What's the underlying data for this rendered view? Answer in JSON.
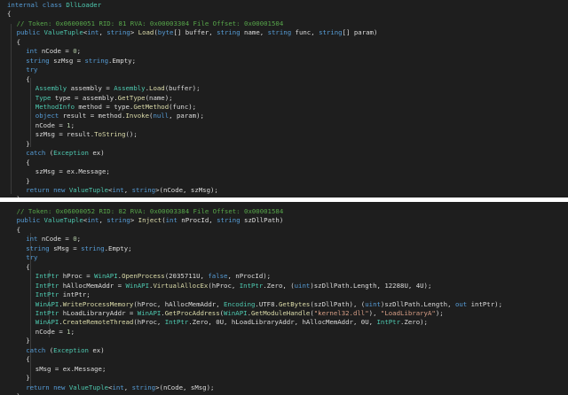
{
  "pane1": {
    "lines": [
      {
        "indent": 0,
        "parts": [
          {
            "k": "kw",
            "t": "internal class "
          },
          {
            "k": "type",
            "t": "DllLoader"
          }
        ]
      },
      {
        "indent": 0,
        "parts": [
          {
            "k": "plain",
            "t": "{"
          }
        ]
      },
      {
        "indent": 1,
        "parts": [
          {
            "k": "comment",
            "t": "// Token: 0x06000051 RID: 81 RVA: 0x00003304 File Offset: 0x00001504"
          }
        ]
      },
      {
        "indent": 1,
        "parts": [
          {
            "k": "kw",
            "t": "public "
          },
          {
            "k": "type",
            "t": "ValueTuple"
          },
          {
            "k": "plain",
            "t": "<"
          },
          {
            "k": "kw",
            "t": "int"
          },
          {
            "k": "plain",
            "t": ", "
          },
          {
            "k": "kw",
            "t": "string"
          },
          {
            "k": "plain",
            "t": "> "
          },
          {
            "k": "method",
            "t": "Load"
          },
          {
            "k": "plain",
            "t": "("
          },
          {
            "k": "kw",
            "t": "byte"
          },
          {
            "k": "plain",
            "t": "[] buffer, "
          },
          {
            "k": "kw",
            "t": "string"
          },
          {
            "k": "plain",
            "t": " name, "
          },
          {
            "k": "kw",
            "t": "string"
          },
          {
            "k": "plain",
            "t": " func, "
          },
          {
            "k": "kw",
            "t": "string"
          },
          {
            "k": "plain",
            "t": "[] param)"
          }
        ]
      },
      {
        "indent": 1,
        "parts": [
          {
            "k": "plain",
            "t": "{"
          }
        ]
      },
      {
        "indent": 2,
        "parts": [
          {
            "k": "kw",
            "t": "int"
          },
          {
            "k": "plain",
            "t": " nCode = "
          },
          {
            "k": "num",
            "t": "0"
          },
          {
            "k": "plain",
            "t": ";"
          }
        ]
      },
      {
        "indent": 2,
        "parts": [
          {
            "k": "kw",
            "t": "string"
          },
          {
            "k": "plain",
            "t": " szMsg = "
          },
          {
            "k": "kw",
            "t": "string"
          },
          {
            "k": "plain",
            "t": ".Empty;"
          }
        ]
      },
      {
        "indent": 2,
        "parts": [
          {
            "k": "kw",
            "t": "try"
          }
        ]
      },
      {
        "indent": 2,
        "parts": [
          {
            "k": "plain",
            "t": "{"
          }
        ]
      },
      {
        "indent": 3,
        "parts": [
          {
            "k": "type",
            "t": "Assembly"
          },
          {
            "k": "plain",
            "t": " assembly = "
          },
          {
            "k": "type",
            "t": "Assembly"
          },
          {
            "k": "plain",
            "t": "."
          },
          {
            "k": "method",
            "t": "Load"
          },
          {
            "k": "plain",
            "t": "(buffer);"
          }
        ]
      },
      {
        "indent": 3,
        "parts": [
          {
            "k": "type",
            "t": "Type"
          },
          {
            "k": "plain",
            "t": " type = assembly."
          },
          {
            "k": "method",
            "t": "GetType"
          },
          {
            "k": "plain",
            "t": "(name);"
          }
        ]
      },
      {
        "indent": 3,
        "parts": [
          {
            "k": "type",
            "t": "MethodInfo"
          },
          {
            "k": "plain",
            "t": " method = type."
          },
          {
            "k": "method",
            "t": "GetMethod"
          },
          {
            "k": "plain",
            "t": "(func);"
          }
        ]
      },
      {
        "indent": 3,
        "parts": [
          {
            "k": "kw",
            "t": "object"
          },
          {
            "k": "plain",
            "t": " result = method."
          },
          {
            "k": "method",
            "t": "Invoke"
          },
          {
            "k": "plain",
            "t": "("
          },
          {
            "k": "kw",
            "t": "null"
          },
          {
            "k": "plain",
            "t": ", param);"
          }
        ]
      },
      {
        "indent": 3,
        "parts": [
          {
            "k": "plain",
            "t": "nCode = "
          },
          {
            "k": "num",
            "t": "1"
          },
          {
            "k": "plain",
            "t": ";"
          }
        ]
      },
      {
        "indent": 3,
        "parts": [
          {
            "k": "plain",
            "t": "szMsg = result."
          },
          {
            "k": "method",
            "t": "ToString"
          },
          {
            "k": "plain",
            "t": "();"
          }
        ]
      },
      {
        "indent": 2,
        "parts": [
          {
            "k": "plain",
            "t": "}"
          }
        ]
      },
      {
        "indent": 2,
        "parts": [
          {
            "k": "kw",
            "t": "catch"
          },
          {
            "k": "plain",
            "t": " ("
          },
          {
            "k": "type",
            "t": "Exception"
          },
          {
            "k": "plain",
            "t": " ex)"
          }
        ]
      },
      {
        "indent": 2,
        "parts": [
          {
            "k": "plain",
            "t": "{"
          }
        ]
      },
      {
        "indent": 3,
        "parts": [
          {
            "k": "plain",
            "t": "szMsg = ex.Message;"
          }
        ]
      },
      {
        "indent": 2,
        "parts": [
          {
            "k": "plain",
            "t": "}"
          }
        ]
      },
      {
        "indent": 2,
        "parts": [
          {
            "k": "kw",
            "t": "return new "
          },
          {
            "k": "type",
            "t": "ValueTuple"
          },
          {
            "k": "plain",
            "t": "<"
          },
          {
            "k": "kw",
            "t": "int"
          },
          {
            "k": "plain",
            "t": ", "
          },
          {
            "k": "kw",
            "t": "string"
          },
          {
            "k": "plain",
            "t": ">(nCode, szMsg);"
          }
        ]
      },
      {
        "indent": 1,
        "parts": [
          {
            "k": "plain",
            "t": "}"
          }
        ]
      }
    ]
  },
  "pane2": {
    "lines": [
      {
        "indent": 1,
        "parts": [
          {
            "k": "comment",
            "t": "// Token: 0x06000052 RID: 82 RVA: 0x00003384 File Offset: 0x00001584"
          }
        ]
      },
      {
        "indent": 1,
        "parts": [
          {
            "k": "kw",
            "t": "public "
          },
          {
            "k": "type",
            "t": "ValueTuple"
          },
          {
            "k": "plain",
            "t": "<"
          },
          {
            "k": "kw",
            "t": "int"
          },
          {
            "k": "plain",
            "t": ", "
          },
          {
            "k": "kw",
            "t": "string"
          },
          {
            "k": "plain",
            "t": "> "
          },
          {
            "k": "method",
            "t": "Inject"
          },
          {
            "k": "plain",
            "t": "("
          },
          {
            "k": "kw",
            "t": "int"
          },
          {
            "k": "plain",
            "t": " nProcId, "
          },
          {
            "k": "kw",
            "t": "string"
          },
          {
            "k": "plain",
            "t": " szDllPath)"
          }
        ]
      },
      {
        "indent": 1,
        "parts": [
          {
            "k": "plain",
            "t": "{"
          }
        ]
      },
      {
        "indent": 2,
        "parts": [
          {
            "k": "kw",
            "t": "int"
          },
          {
            "k": "plain",
            "t": " nCode = "
          },
          {
            "k": "num",
            "t": "0"
          },
          {
            "k": "plain",
            "t": ";"
          }
        ]
      },
      {
        "indent": 2,
        "parts": [
          {
            "k": "kw",
            "t": "string"
          },
          {
            "k": "plain",
            "t": " sMsg = "
          },
          {
            "k": "kw",
            "t": "string"
          },
          {
            "k": "plain",
            "t": ".Empty;"
          }
        ]
      },
      {
        "indent": 2,
        "parts": [
          {
            "k": "kw",
            "t": "try"
          }
        ]
      },
      {
        "indent": 2,
        "parts": [
          {
            "k": "plain",
            "t": "{"
          }
        ]
      },
      {
        "indent": 3,
        "parts": [
          {
            "k": "type",
            "t": "IntPtr"
          },
          {
            "k": "plain",
            "t": " hProc = "
          },
          {
            "k": "type",
            "t": "WinAPI"
          },
          {
            "k": "plain",
            "t": "."
          },
          {
            "k": "method",
            "t": "OpenProcess"
          },
          {
            "k": "plain",
            "t": "(2035711U, "
          },
          {
            "k": "kw",
            "t": "false"
          },
          {
            "k": "plain",
            "t": ", nProcId);"
          }
        ]
      },
      {
        "indent": 3,
        "parts": [
          {
            "k": "type",
            "t": "IntPtr"
          },
          {
            "k": "plain",
            "t": " hAllocMemAddr = "
          },
          {
            "k": "type",
            "t": "WinAPI"
          },
          {
            "k": "plain",
            "t": "."
          },
          {
            "k": "method",
            "t": "VirtualAllocEx"
          },
          {
            "k": "plain",
            "t": "(hProc, "
          },
          {
            "k": "type",
            "t": "IntPtr"
          },
          {
            "k": "plain",
            "t": ".Zero, ("
          },
          {
            "k": "kw",
            "t": "uint"
          },
          {
            "k": "plain",
            "t": ")szDllPath.Length, 12288U, 4U);"
          }
        ]
      },
      {
        "indent": 3,
        "parts": [
          {
            "k": "type",
            "t": "IntPtr"
          },
          {
            "k": "plain",
            "t": " intPtr;"
          }
        ]
      },
      {
        "indent": 3,
        "parts": [
          {
            "k": "type",
            "t": "WinAPI"
          },
          {
            "k": "plain",
            "t": "."
          },
          {
            "k": "method",
            "t": "WriteProcessMemory"
          },
          {
            "k": "plain",
            "t": "(hProc, hAllocMemAddr, "
          },
          {
            "k": "type",
            "t": "Encoding"
          },
          {
            "k": "plain",
            "t": ".UTF8."
          },
          {
            "k": "method",
            "t": "GetBytes"
          },
          {
            "k": "plain",
            "t": "(szDllPath), ("
          },
          {
            "k": "kw",
            "t": "uint"
          },
          {
            "k": "plain",
            "t": ")szDllPath.Length, "
          },
          {
            "k": "kw",
            "t": "out"
          },
          {
            "k": "plain",
            "t": " intPtr);"
          }
        ]
      },
      {
        "indent": 3,
        "parts": [
          {
            "k": "type",
            "t": "IntPtr"
          },
          {
            "k": "plain",
            "t": " hLoadLibraryAddr = "
          },
          {
            "k": "type",
            "t": "WinAPI"
          },
          {
            "k": "plain",
            "t": "."
          },
          {
            "k": "method",
            "t": "GetProcAddress"
          },
          {
            "k": "plain",
            "t": "("
          },
          {
            "k": "type",
            "t": "WinAPI"
          },
          {
            "k": "plain",
            "t": "."
          },
          {
            "k": "method",
            "t": "GetModuleHandle"
          },
          {
            "k": "plain",
            "t": "("
          },
          {
            "k": "str",
            "t": "\"kernel32.dll\""
          },
          {
            "k": "plain",
            "t": "), "
          },
          {
            "k": "str",
            "t": "\"LoadLibraryA\""
          },
          {
            "k": "plain",
            "t": ");"
          }
        ]
      },
      {
        "indent": 3,
        "parts": [
          {
            "k": "type",
            "t": "WinAPI"
          },
          {
            "k": "plain",
            "t": "."
          },
          {
            "k": "method",
            "t": "CreateRemoteThread"
          },
          {
            "k": "plain",
            "t": "(hProc, "
          },
          {
            "k": "type",
            "t": "IntPtr"
          },
          {
            "k": "plain",
            "t": ".Zero, 0U, hLoadLibraryAddr, hAllocMemAddr, 0U, "
          },
          {
            "k": "type",
            "t": "IntPtr"
          },
          {
            "k": "plain",
            "t": ".Zero);"
          }
        ]
      },
      {
        "indent": 3,
        "parts": [
          {
            "k": "plain",
            "t": "nCode = "
          },
          {
            "k": "num",
            "t": "1"
          },
          {
            "k": "plain",
            "t": ";"
          }
        ]
      },
      {
        "indent": 2,
        "parts": [
          {
            "k": "plain",
            "t": "}"
          }
        ]
      },
      {
        "indent": 2,
        "parts": [
          {
            "k": "kw",
            "t": "catch"
          },
          {
            "k": "plain",
            "t": " ("
          },
          {
            "k": "type",
            "t": "Exception"
          },
          {
            "k": "plain",
            "t": " ex)"
          }
        ]
      },
      {
        "indent": 2,
        "parts": [
          {
            "k": "plain",
            "t": "{"
          }
        ]
      },
      {
        "indent": 3,
        "parts": [
          {
            "k": "plain",
            "t": "sMsg = ex.Message;"
          }
        ]
      },
      {
        "indent": 2,
        "parts": [
          {
            "k": "plain",
            "t": "}"
          }
        ]
      },
      {
        "indent": 2,
        "parts": [
          {
            "k": "kw",
            "t": "return new "
          },
          {
            "k": "type",
            "t": "ValueTuple"
          },
          {
            "k": "plain",
            "t": "<"
          },
          {
            "k": "kw",
            "t": "int"
          },
          {
            "k": "plain",
            "t": ", "
          },
          {
            "k": "kw",
            "t": "string"
          },
          {
            "k": "plain",
            "t": ">(nCode, sMsg);"
          }
        ]
      },
      {
        "indent": 1,
        "parts": [
          {
            "k": "plain",
            "t": "}"
          }
        ]
      }
    ]
  }
}
